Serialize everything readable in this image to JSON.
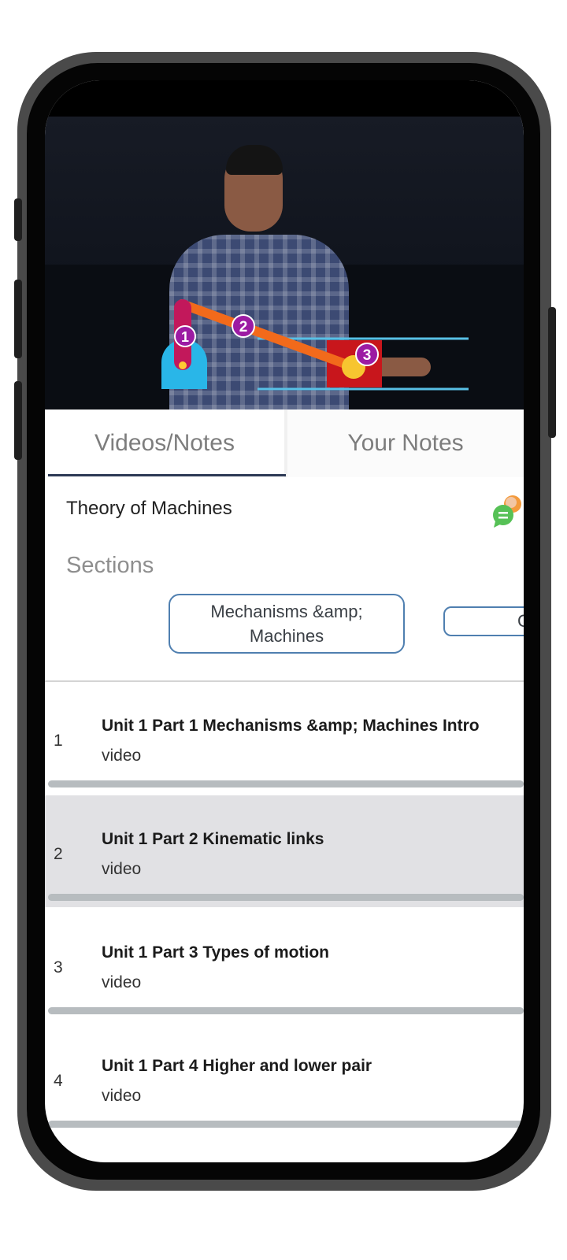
{
  "video": {
    "markers": [
      "1",
      "2",
      "3"
    ],
    "colors": {
      "crank": "#c2185b",
      "link": "#f26a1b",
      "slider": "#c8161c",
      "base": "#29b6e8",
      "marker": "#9c1ba3",
      "rails": "#58c0e6"
    }
  },
  "tabs": [
    {
      "label": "Videos/Notes",
      "selected": true
    },
    {
      "label": "Your Notes",
      "selected": false
    }
  ],
  "course": {
    "title": "Theory of Machines"
  },
  "sections": {
    "label": "Sections",
    "chips": [
      {
        "label": "Mechanisms &amp; Machines",
        "selected": true
      },
      {
        "label": "C",
        "selected": false
      }
    ]
  },
  "lessons": [
    {
      "number": "1",
      "title": "Unit 1 Part 1 Mechanisms &amp; Machines Intro",
      "type": "video",
      "active": false
    },
    {
      "number": "2",
      "title": "Unit 1 Part 2 Kinematic links",
      "type": "video",
      "active": true
    },
    {
      "number": "3",
      "title": "Unit 1 Part 3 Types of motion",
      "type": "video",
      "active": false
    },
    {
      "number": "4",
      "title": "Unit 1 Part 4 Higher and lower pair",
      "type": "video",
      "active": false
    }
  ],
  "icons": {
    "chat": "chat-bubbles-icon"
  }
}
